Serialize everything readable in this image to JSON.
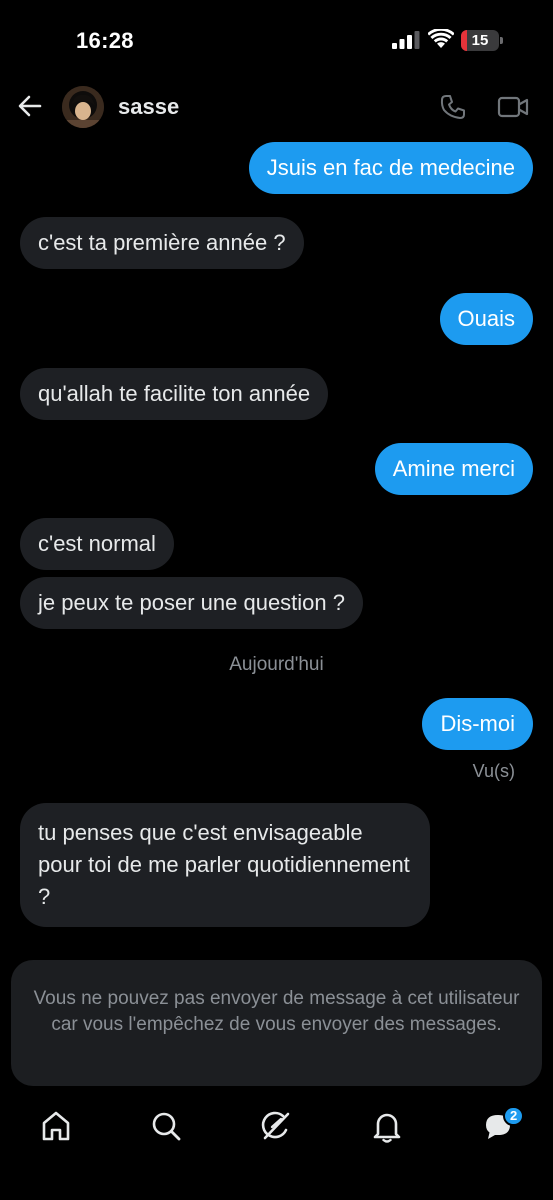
{
  "status_bar": {
    "time": "16:28",
    "battery_level": "15",
    "battery_fraction": 0.15
  },
  "header": {
    "contact_name": "sasse"
  },
  "messages": [
    {
      "direction": "sent",
      "text": "Jsuis en fac de medecine"
    },
    {
      "direction": "received",
      "text": "c'est ta première année ?"
    },
    {
      "direction": "sent",
      "text": "Ouais"
    },
    {
      "direction": "received",
      "text": "qu'allah te facilite ton année"
    },
    {
      "direction": "sent",
      "text": "Amine merci"
    },
    {
      "direction": "received",
      "text": "c'est normal"
    },
    {
      "direction": "received",
      "text": "je peux te poser une question ?"
    },
    {
      "direction": "sent",
      "text": "Dis-moi"
    },
    {
      "direction": "received",
      "text": "tu penses que c'est envisageable pour toi de me parler quotidiennement ?"
    }
  ],
  "day_separator": "Aujourd'hui",
  "seen_label": "Vu(s)",
  "blocked_notice": "Vous ne pouvez pas envoyer de message à cet utilisateur car vous l'empêchez de vous envoyer des messages.",
  "tab_bar": {
    "tabs": [
      {
        "icon": "home-icon"
      },
      {
        "icon": "search-icon"
      },
      {
        "icon": "grok-icon"
      },
      {
        "icon": "bell-icon"
      },
      {
        "icon": "messages-icon"
      }
    ],
    "messages_badge": "2"
  },
  "colors": {
    "accent": "#1d9bf0",
    "received_bubble": "#1e2024",
    "background": "#000000",
    "battery_low": "#e5333a"
  }
}
